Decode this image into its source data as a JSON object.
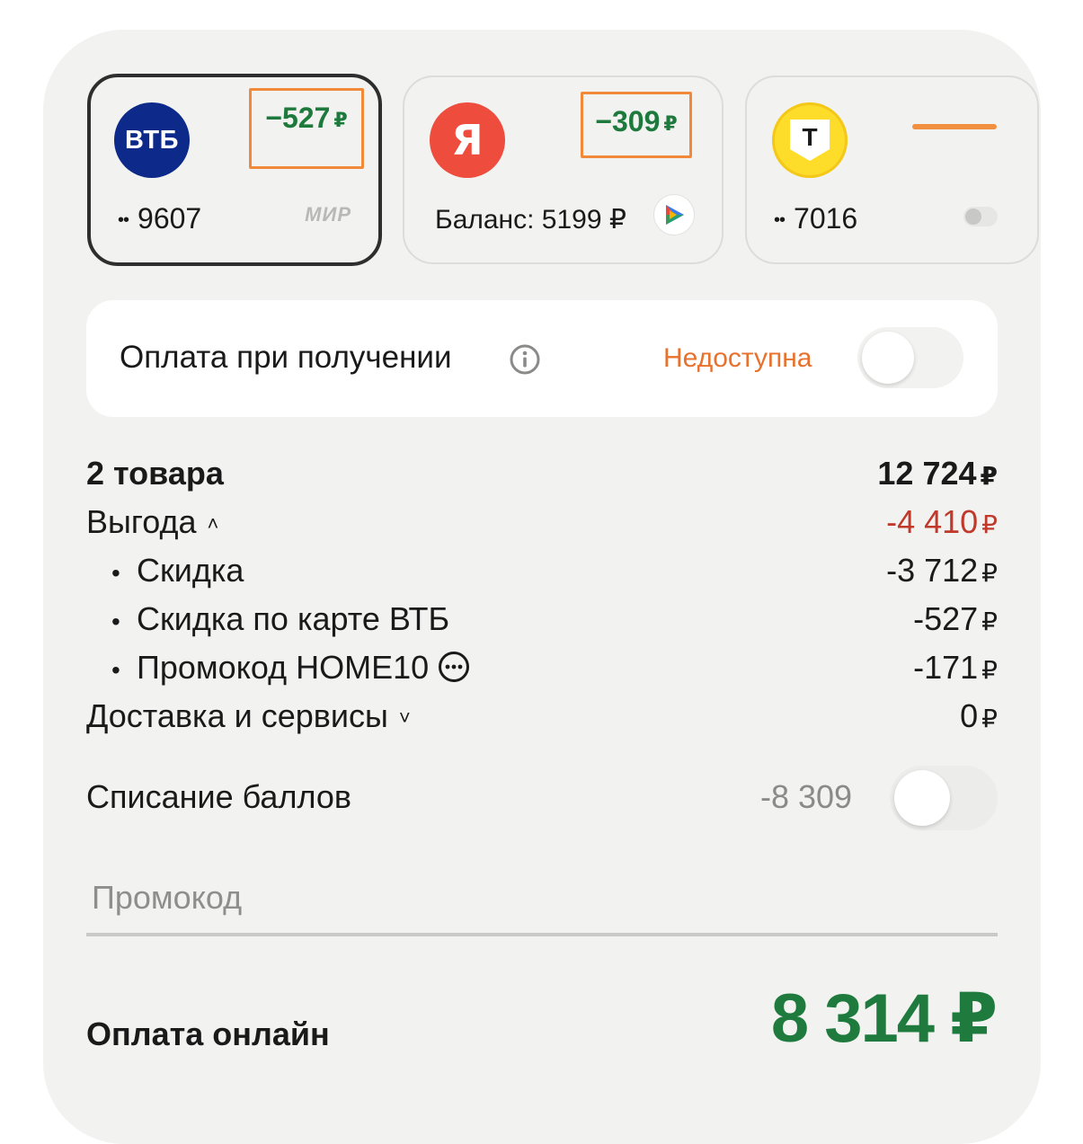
{
  "cards": {
    "vtb": {
      "logo_text": "ВТБ",
      "discount": "−527",
      "currency": "₽",
      "number_dots": "••",
      "number": "9607",
      "network": "МИР"
    },
    "yandex": {
      "logo_text": "Я",
      "discount": "−309",
      "currency": "₽",
      "balance": "Баланс: 5199 ₽"
    },
    "tbank": {
      "logo_text": "T",
      "number_dots": "••",
      "number": "7016"
    }
  },
  "cash_on_delivery": {
    "label": "Оплата при получении",
    "status": "Недоступна",
    "status_color": "#e8712d",
    "enabled": false
  },
  "summary": {
    "items": {
      "label": "2 товара",
      "value": "12 724",
      "currency": "₽"
    },
    "benefit": {
      "label": "Выгода",
      "value": "-4 410",
      "currency": "₽",
      "color": "#c0392b"
    },
    "discount": {
      "label": "Скидка",
      "value": "-3 712",
      "currency": "₽"
    },
    "card_discount": {
      "label": "Скидка по карте ВТБ",
      "value": "-527",
      "currency": "₽"
    },
    "promo_discount": {
      "label": "Промокод HOME10",
      "value": "-171",
      "currency": "₽"
    },
    "delivery": {
      "label": "Доставка и сервисы",
      "value": "0",
      "currency": "₽"
    }
  },
  "points": {
    "label": "Списание баллов",
    "value": "-8 309",
    "enabled": false
  },
  "promo_input": {
    "placeholder": "Промокод",
    "value": ""
  },
  "total": {
    "label": "Оплата онлайн",
    "value": "8 314 ₽",
    "color": "#1f7a3d"
  }
}
